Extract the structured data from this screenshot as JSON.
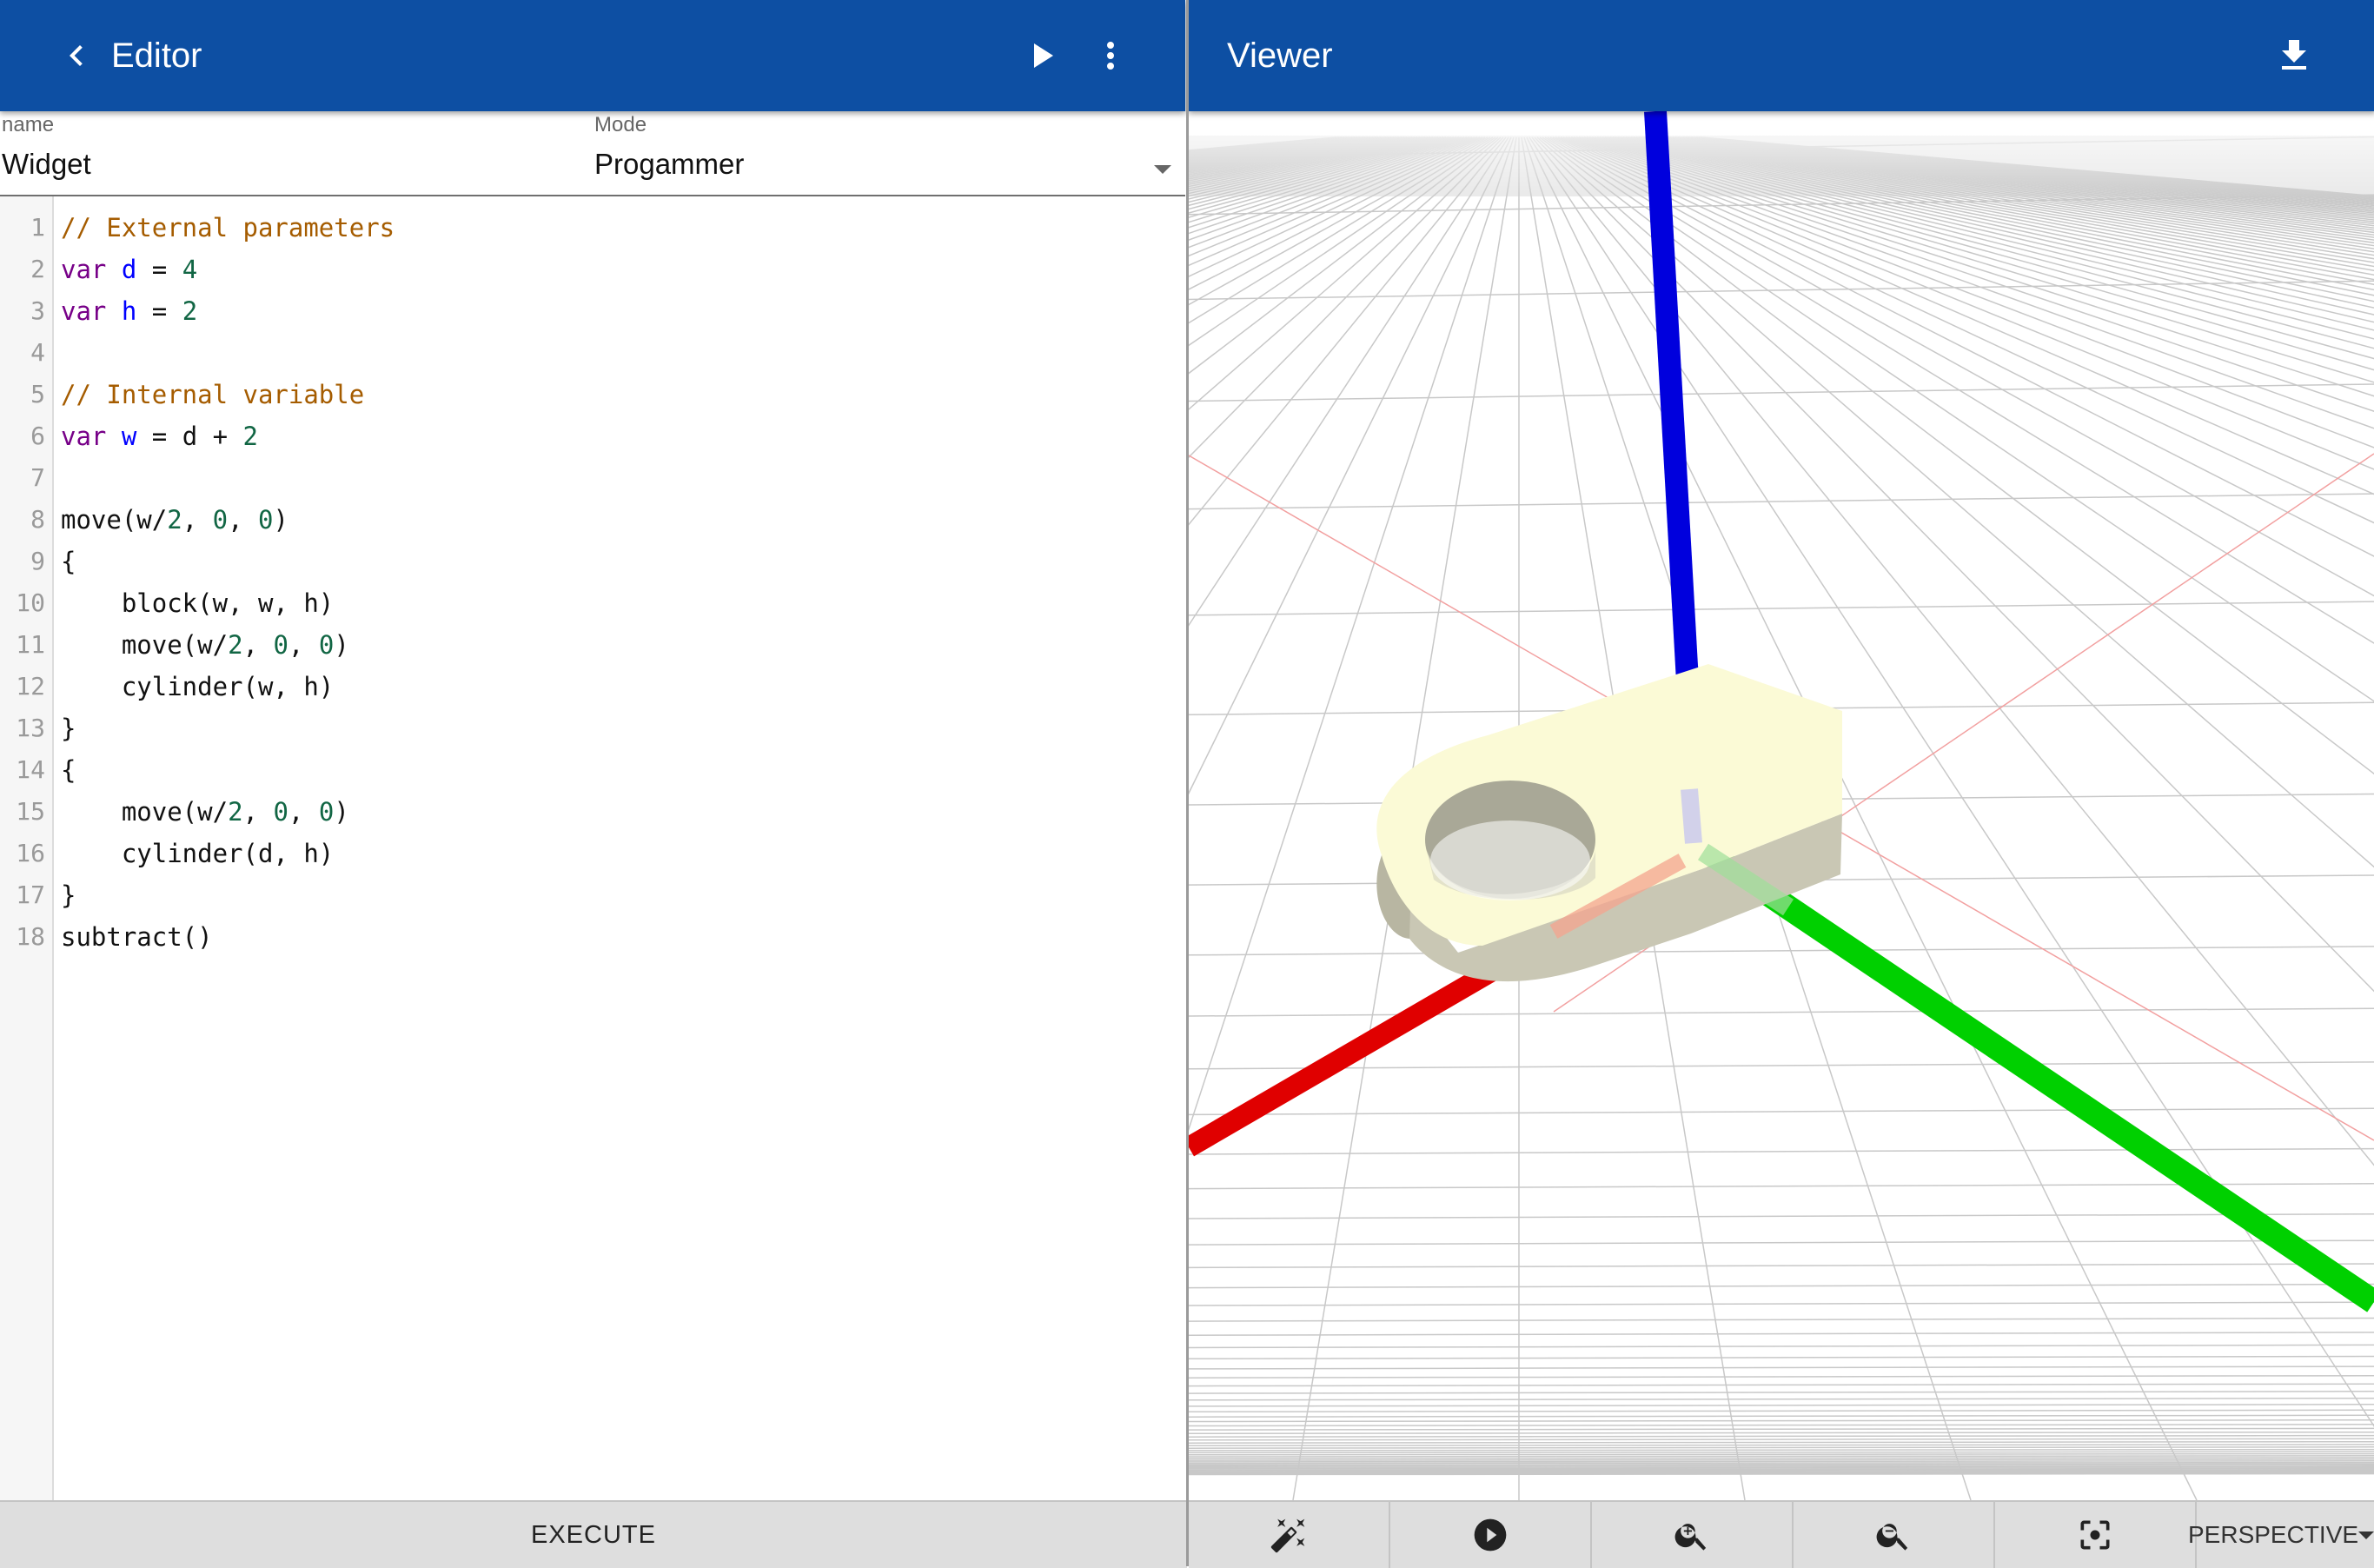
{
  "editor": {
    "title": "Editor",
    "back_icon": "chevron-left-icon",
    "run_icon": "play-icon",
    "menu_icon": "more-vert-icon",
    "name_label": "name",
    "name_value": "Widget",
    "mode_label": "Mode",
    "mode_value": "Progammer",
    "code_lines": [
      [
        {
          "t": "// External parameters",
          "c": "comment"
        }
      ],
      [
        {
          "t": "var",
          "c": "keyword"
        },
        {
          "t": " "
        },
        {
          "t": "d",
          "c": "def"
        },
        {
          "t": " = "
        },
        {
          "t": "4",
          "c": "number"
        }
      ],
      [
        {
          "t": "var",
          "c": "keyword"
        },
        {
          "t": " "
        },
        {
          "t": "h",
          "c": "def"
        },
        {
          "t": " = "
        },
        {
          "t": "2",
          "c": "number"
        }
      ],
      [],
      [
        {
          "t": "// Internal variable",
          "c": "comment"
        }
      ],
      [
        {
          "t": "var",
          "c": "keyword"
        },
        {
          "t": " "
        },
        {
          "t": "w",
          "c": "def"
        },
        {
          "t": " = d + "
        },
        {
          "t": "2",
          "c": "number"
        }
      ],
      [],
      [
        {
          "t": "move(w/"
        },
        {
          "t": "2",
          "c": "number"
        },
        {
          "t": ", "
        },
        {
          "t": "0",
          "c": "number"
        },
        {
          "t": ", "
        },
        {
          "t": "0",
          "c": "number"
        },
        {
          "t": ")"
        }
      ],
      [
        {
          "t": "{"
        }
      ],
      [
        {
          "t": "    block(w, w, h)"
        }
      ],
      [
        {
          "t": "    move(w/"
        },
        {
          "t": "2",
          "c": "number"
        },
        {
          "t": ", "
        },
        {
          "t": "0",
          "c": "number"
        },
        {
          "t": ", "
        },
        {
          "t": "0",
          "c": "number"
        },
        {
          "t": ")"
        }
      ],
      [
        {
          "t": "    cylinder(w, h)"
        }
      ],
      [
        {
          "t": "}"
        }
      ],
      [
        {
          "t": "{"
        }
      ],
      [
        {
          "t": "    move(w/"
        },
        {
          "t": "2",
          "c": "number"
        },
        {
          "t": ", "
        },
        {
          "t": "0",
          "c": "number"
        },
        {
          "t": ", "
        },
        {
          "t": "0",
          "c": "number"
        },
        {
          "t": ")"
        }
      ],
      [
        {
          "t": "    cylinder(d, h)"
        }
      ],
      [
        {
          "t": "}"
        }
      ],
      [
        {
          "t": "subtract()"
        }
      ]
    ],
    "execute_label": "EXECUTE"
  },
  "viewer": {
    "title": "Viewer",
    "download_icon": "download-icon",
    "axis_colors": {
      "x": "#e00000",
      "y": "#00d000",
      "z": "#0000dd"
    },
    "toolbar": {
      "icons": [
        "magic-wand-icon",
        "play-circle-icon",
        "zoom-in-icon",
        "zoom-out-icon",
        "center-focus-icon"
      ],
      "projection": "PERSPECTIVE"
    }
  },
  "colors": {
    "appbar": "#0d4fa3",
    "model_top": "#fbfad6",
    "model_side": "#c9c7b4"
  }
}
